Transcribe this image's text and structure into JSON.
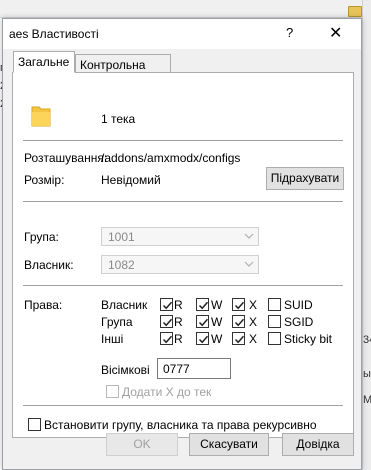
{
  "window": {
    "title": "aes Властивості",
    "help_glyph": "?",
    "close_glyph": "✕"
  },
  "tabs": [
    {
      "label": "Загальне",
      "active": true
    },
    {
      "label": "Контрольна сума",
      "active": false
    }
  ],
  "general": {
    "item_count": "1 тека",
    "location_label": "Розташування:",
    "location_value": "/addons/amxmodx/configs",
    "size_label": "Розмір:",
    "size_value": "Невідомий",
    "calculate_label": "Підрахувати",
    "group_label": "Група:",
    "group_value": "1001",
    "owner_label": "Власник:",
    "owner_value": "1082",
    "rights_label": "Права:"
  },
  "permissions": {
    "rows": [
      {
        "label": "Власник",
        "r": true,
        "w": true,
        "x": true,
        "extra_label": "SUID",
        "extra": false
      },
      {
        "label": "Група",
        "r": true,
        "w": true,
        "x": true,
        "extra_label": "SGID",
        "extra": false
      },
      {
        "label": "Інші",
        "r": true,
        "w": true,
        "x": true,
        "extra_label": "Sticky bit",
        "extra": false
      }
    ],
    "col_r": "R",
    "col_w": "W",
    "col_x": "X",
    "octal_label": "Вісімкові",
    "octal_value": "0777",
    "add_x_label": "Додати X до тек",
    "recursive_label": "Встановити групу, власника та права рекурсивно"
  },
  "buttons": {
    "ok": "OK",
    "cancel": "Скасувати",
    "help": "Довідка"
  },
  "background": {
    "glyphs": [
      "п",
      "2",
      "2",
      "34",
      "ы",
      "М"
    ]
  },
  "colors": {
    "folder": "#f4c542",
    "dialog_bg": "#f0f0f0",
    "panel_bg": "#ffffff"
  }
}
